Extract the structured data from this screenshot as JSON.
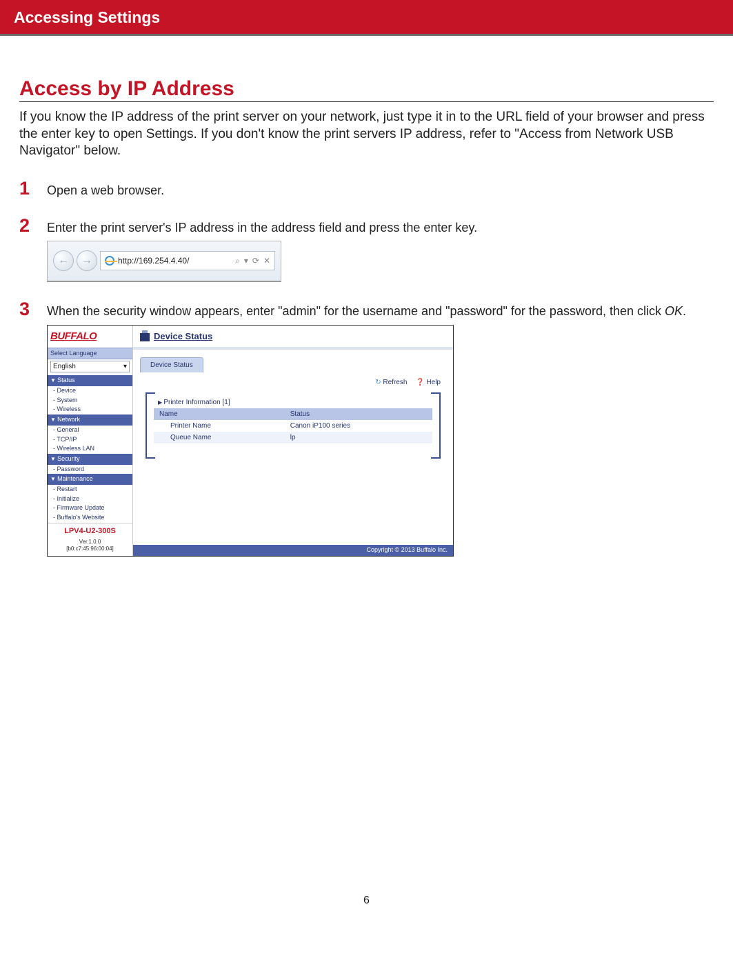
{
  "header": {
    "title": "Accessing Settings"
  },
  "section": {
    "title": "Access by IP Address",
    "intro": "If you know the IP address of the print server on your network, just type it in to the URL field of your browser and press the enter key to open Settings. If you don't know the print servers IP address, refer to \"Access from Network USB Navigator\" below."
  },
  "steps": {
    "s1": {
      "num": "1",
      "text": "Open a web browser."
    },
    "s2": {
      "num": "2",
      "text": "Enter the print server's IP address in the address field and press the enter key."
    },
    "s3": {
      "num": "3",
      "text_a": "When the security window appears, enter \"admin\" for the username and \"password\" for the password, then click ",
      "ok": "OK",
      "text_b": "."
    }
  },
  "browser": {
    "url": "http://169.254.4.40/",
    "search_glyph": "⌕"
  },
  "admin": {
    "logo": "BUFFALO",
    "select_lang_label": "Select Language",
    "lang_value": "English",
    "cats": {
      "status": {
        "label": "Status",
        "items": [
          "Device",
          "System",
          "Wireless"
        ]
      },
      "network": {
        "label": "Network",
        "items": [
          "General",
          "TCP/IP",
          "Wireless LAN"
        ]
      },
      "security": {
        "label": "Security",
        "items": [
          "Password"
        ]
      },
      "maintenance": {
        "label": "Maintenance",
        "items": [
          "Restart",
          "Initialize",
          "Firmware Update",
          "Buffalo's Website"
        ]
      }
    },
    "model": "LPV4-U2-300S",
    "version": "Ver.1.0.0",
    "mac": "[b0:c7:45:96:00:04]",
    "main_title": "Device Status",
    "tab": "Device Status",
    "refresh": "Refresh",
    "help": "Help",
    "printer_info": "Printer Information [1]",
    "col_name": "Name",
    "col_status": "Status",
    "row1_name": "Printer Name",
    "row1_status": "Canon iP100 series",
    "row2_name": "Queue Name",
    "row2_status": "lp",
    "copyright": "Copyright © 2013 Buffalo Inc."
  },
  "page_number": "6"
}
